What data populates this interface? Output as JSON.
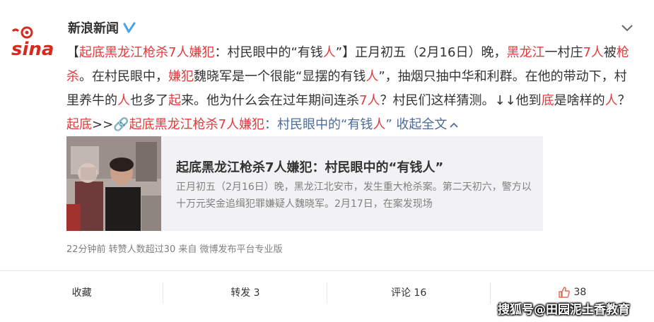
{
  "header": {
    "author": "新浪新闻",
    "verified_icon": "verified-v-icon",
    "more_icon": "chevron-down-icon"
  },
  "post": {
    "segments": [
      {
        "t": "【",
        "c": "n"
      },
      {
        "t": "起底黑龙江枪杀7人嫌犯",
        "c": "r"
      },
      {
        "t": "：村民眼中的“有钱",
        "c": "n"
      },
      {
        "t": "人",
        "c": "r"
      },
      {
        "t": "”】正月初五（2月16日）晚，",
        "c": "n"
      },
      {
        "t": "黑龙江",
        "c": "r"
      },
      {
        "t": "一村庄",
        "c": "n"
      },
      {
        "t": "7人",
        "c": "r"
      },
      {
        "t": "被",
        "c": "n"
      },
      {
        "t": "枪杀",
        "c": "r"
      },
      {
        "t": "。在村民眼中，",
        "c": "n"
      },
      {
        "t": "嫌犯",
        "c": "r"
      },
      {
        "t": "魏晓军是一个很能“显摆的有钱",
        "c": "n"
      },
      {
        "t": "人",
        "c": "r"
      },
      {
        "t": "”，抽烟只抽中华和利群。在他的带动下，村里养牛的",
        "c": "n"
      },
      {
        "t": "人",
        "c": "r"
      },
      {
        "t": "也多了",
        "c": "n"
      },
      {
        "t": "起",
        "c": "r"
      },
      {
        "t": "来。他为什么会在过年期间连杀",
        "c": "n"
      },
      {
        "t": "7人",
        "c": "r"
      },
      {
        "t": "？村民们这样猜测。↓↓他到",
        "c": "n"
      },
      {
        "t": "底",
        "c": "r"
      },
      {
        "t": "是啥样的",
        "c": "n"
      },
      {
        "t": "人",
        "c": "r"
      },
      {
        "t": "？",
        "c": "n"
      },
      {
        "t": "起底",
        "c": "r"
      },
      {
        "t": ">>",
        "c": "n"
      },
      {
        "t": "🔗",
        "c": "b"
      },
      {
        "t": "起底黑龙江枪杀7人嫌犯",
        "c": "r"
      },
      {
        "t": "：村民眼中的“有钱",
        "c": "b"
      },
      {
        "t": "人",
        "c": "r"
      },
      {
        "t": "” 收起全文",
        "c": "b"
      }
    ],
    "collapse_icon": "chevron-up-icon"
  },
  "preview": {
    "title": "起底黑龙江枪杀7人嫌犯：村民眼中的“有钱人”",
    "desc": "正月初五（2月16日）晚，黑龙江北安市，发生重大枪杀案。第二天初六，警方以十万元奖金追缉犯罪嫌疑人魏晓军。2月17日，在案发现场"
  },
  "meta": {
    "text": "22分钟前  转赞人数超过30  来自 微博发布平台专业版"
  },
  "actions": {
    "favorite": "收藏",
    "repost": "转发 3",
    "comment": "评论 16",
    "like": "38"
  },
  "watermark": "搜狐号@田园泥土香教育",
  "colors": {
    "red": "#e4393c",
    "link_blue": "#4d6b99",
    "meta_gray": "#808080",
    "preview_bg": "#f2f2f5",
    "sina_red": "#d52b1e"
  }
}
